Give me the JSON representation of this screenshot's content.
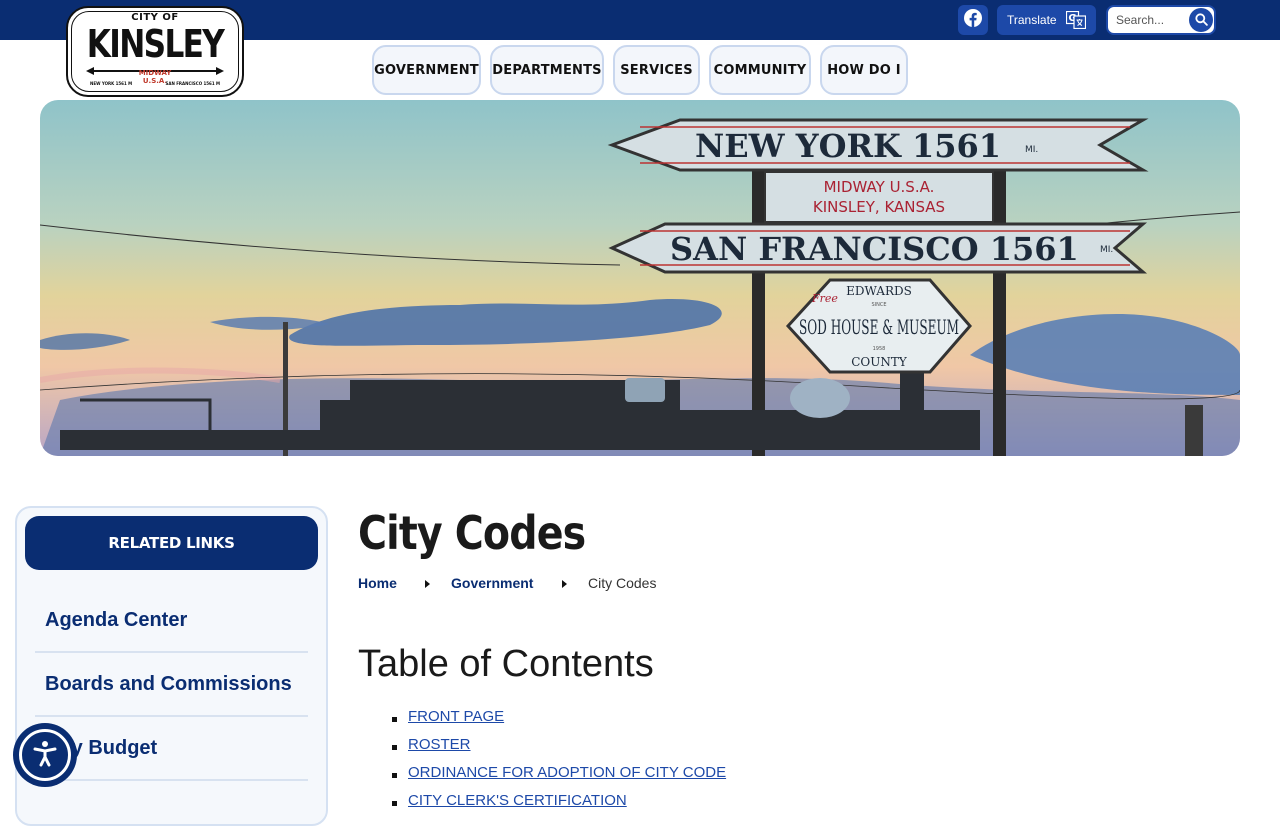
{
  "topbar": {
    "facebook_icon": "facebook-icon",
    "translate_label": "Translate",
    "translate_icon": "google-translate-icon",
    "search_placeholder": "Search...",
    "search_icon": "search-icon"
  },
  "logo": {
    "city_of": "CITY OF",
    "name": "KINSLEY",
    "midway": "MIDWAY",
    "usa": "U.S.A.",
    "new_york": "NEW YORK 1561 M",
    "san_francisco": "SAN FRANCISCO 1561 M"
  },
  "nav": {
    "items": [
      "GOVERNMENT",
      "DEPARTMENTS",
      "SERVICES",
      "COMMUNITY",
      "HOW DO I"
    ]
  },
  "hero": {
    "sign_new_york": "NEW YORK 1561",
    "sign_ny_unit": "MI.",
    "sign_midway_1": "MIDWAY U.S.A.",
    "sign_midway_2": "KINSLEY, KANSAS",
    "sign_san_francisco": "SAN FRANCISCO 1561",
    "sign_sf_unit": "MI.",
    "sign_free": "Free",
    "sign_edwards": "EDWARDS",
    "sign_since": "SINCE",
    "sign_sod_house": "SOD HOUSE & MUSEUM",
    "sign_1958": "1958",
    "sign_county": "COUNTY"
  },
  "sidebar": {
    "heading": "RELATED LINKS",
    "items": [
      "Agenda Center",
      "Boards and Commissions",
      "City Budget"
    ]
  },
  "accessibility": {
    "icon": "accessibility-icon"
  },
  "main": {
    "title": "City Codes",
    "breadcrumb": [
      "Home",
      "Government",
      "City Codes"
    ],
    "toc_title": "Table of Contents",
    "toc_items": [
      "FRONT PAGE",
      "ROSTER",
      "ORDINANCE FOR ADOPTION OF CITY CODE",
      "CITY CLERK'S CERTIFICATION"
    ]
  },
  "colors": {
    "primary": "#0a2d72",
    "button_blue": "#1d49a8",
    "link": "#1d49a8",
    "nav_bg": "#f3f6fb",
    "sidebar_bg": "#f5f8fc"
  }
}
